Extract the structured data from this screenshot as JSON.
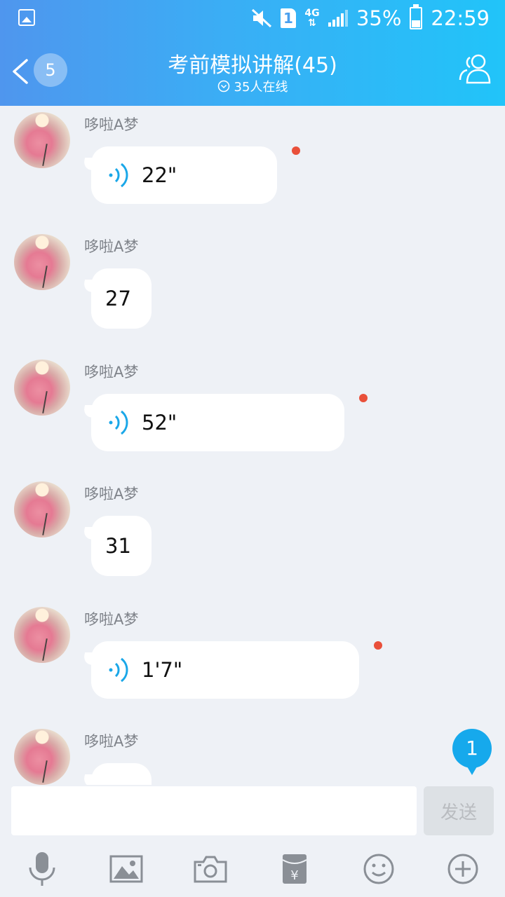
{
  "status_bar": {
    "battery": "35%",
    "time": "22:59",
    "sim": "1",
    "network": "4G",
    "icons": [
      "gallery-icon",
      "mute-icon",
      "sim-icon",
      "signal-icon",
      "battery-icon"
    ]
  },
  "header": {
    "back_count": "5",
    "title": "考前模拟讲解(45)",
    "online": "35人在线",
    "icons": [
      "back-icon",
      "chevron-circle-icon",
      "members-icon"
    ]
  },
  "messages": [
    {
      "sender": "哆啦A梦",
      "type": "voice",
      "content": "22\"",
      "unread": true
    },
    {
      "sender": "哆啦A梦",
      "type": "text",
      "content": "27",
      "unread": false
    },
    {
      "sender": "哆啦A梦",
      "type": "voice",
      "content": "52\"",
      "unread": true
    },
    {
      "sender": "哆啦A梦",
      "type": "text",
      "content": "31",
      "unread": false
    },
    {
      "sender": "哆啦A梦",
      "type": "voice",
      "content": "1'7\"",
      "unread": true
    },
    {
      "sender": "哆啦A梦",
      "type": "text",
      "content": "",
      "unread": false
    }
  ],
  "new_messages_badge": "1",
  "input": {
    "value": "",
    "placeholder": "",
    "send_label": "发送"
  },
  "toolbar": [
    "microphone-icon",
    "image-icon",
    "camera-icon",
    "red-packet-icon",
    "emoji-icon",
    "plus-icon"
  ],
  "colors": {
    "header_start": "#4f96ee",
    "header_end": "#21c4f9",
    "accent": "#16a9ec",
    "unread_dot": "#e9503a",
    "background": "#eef1f6"
  }
}
